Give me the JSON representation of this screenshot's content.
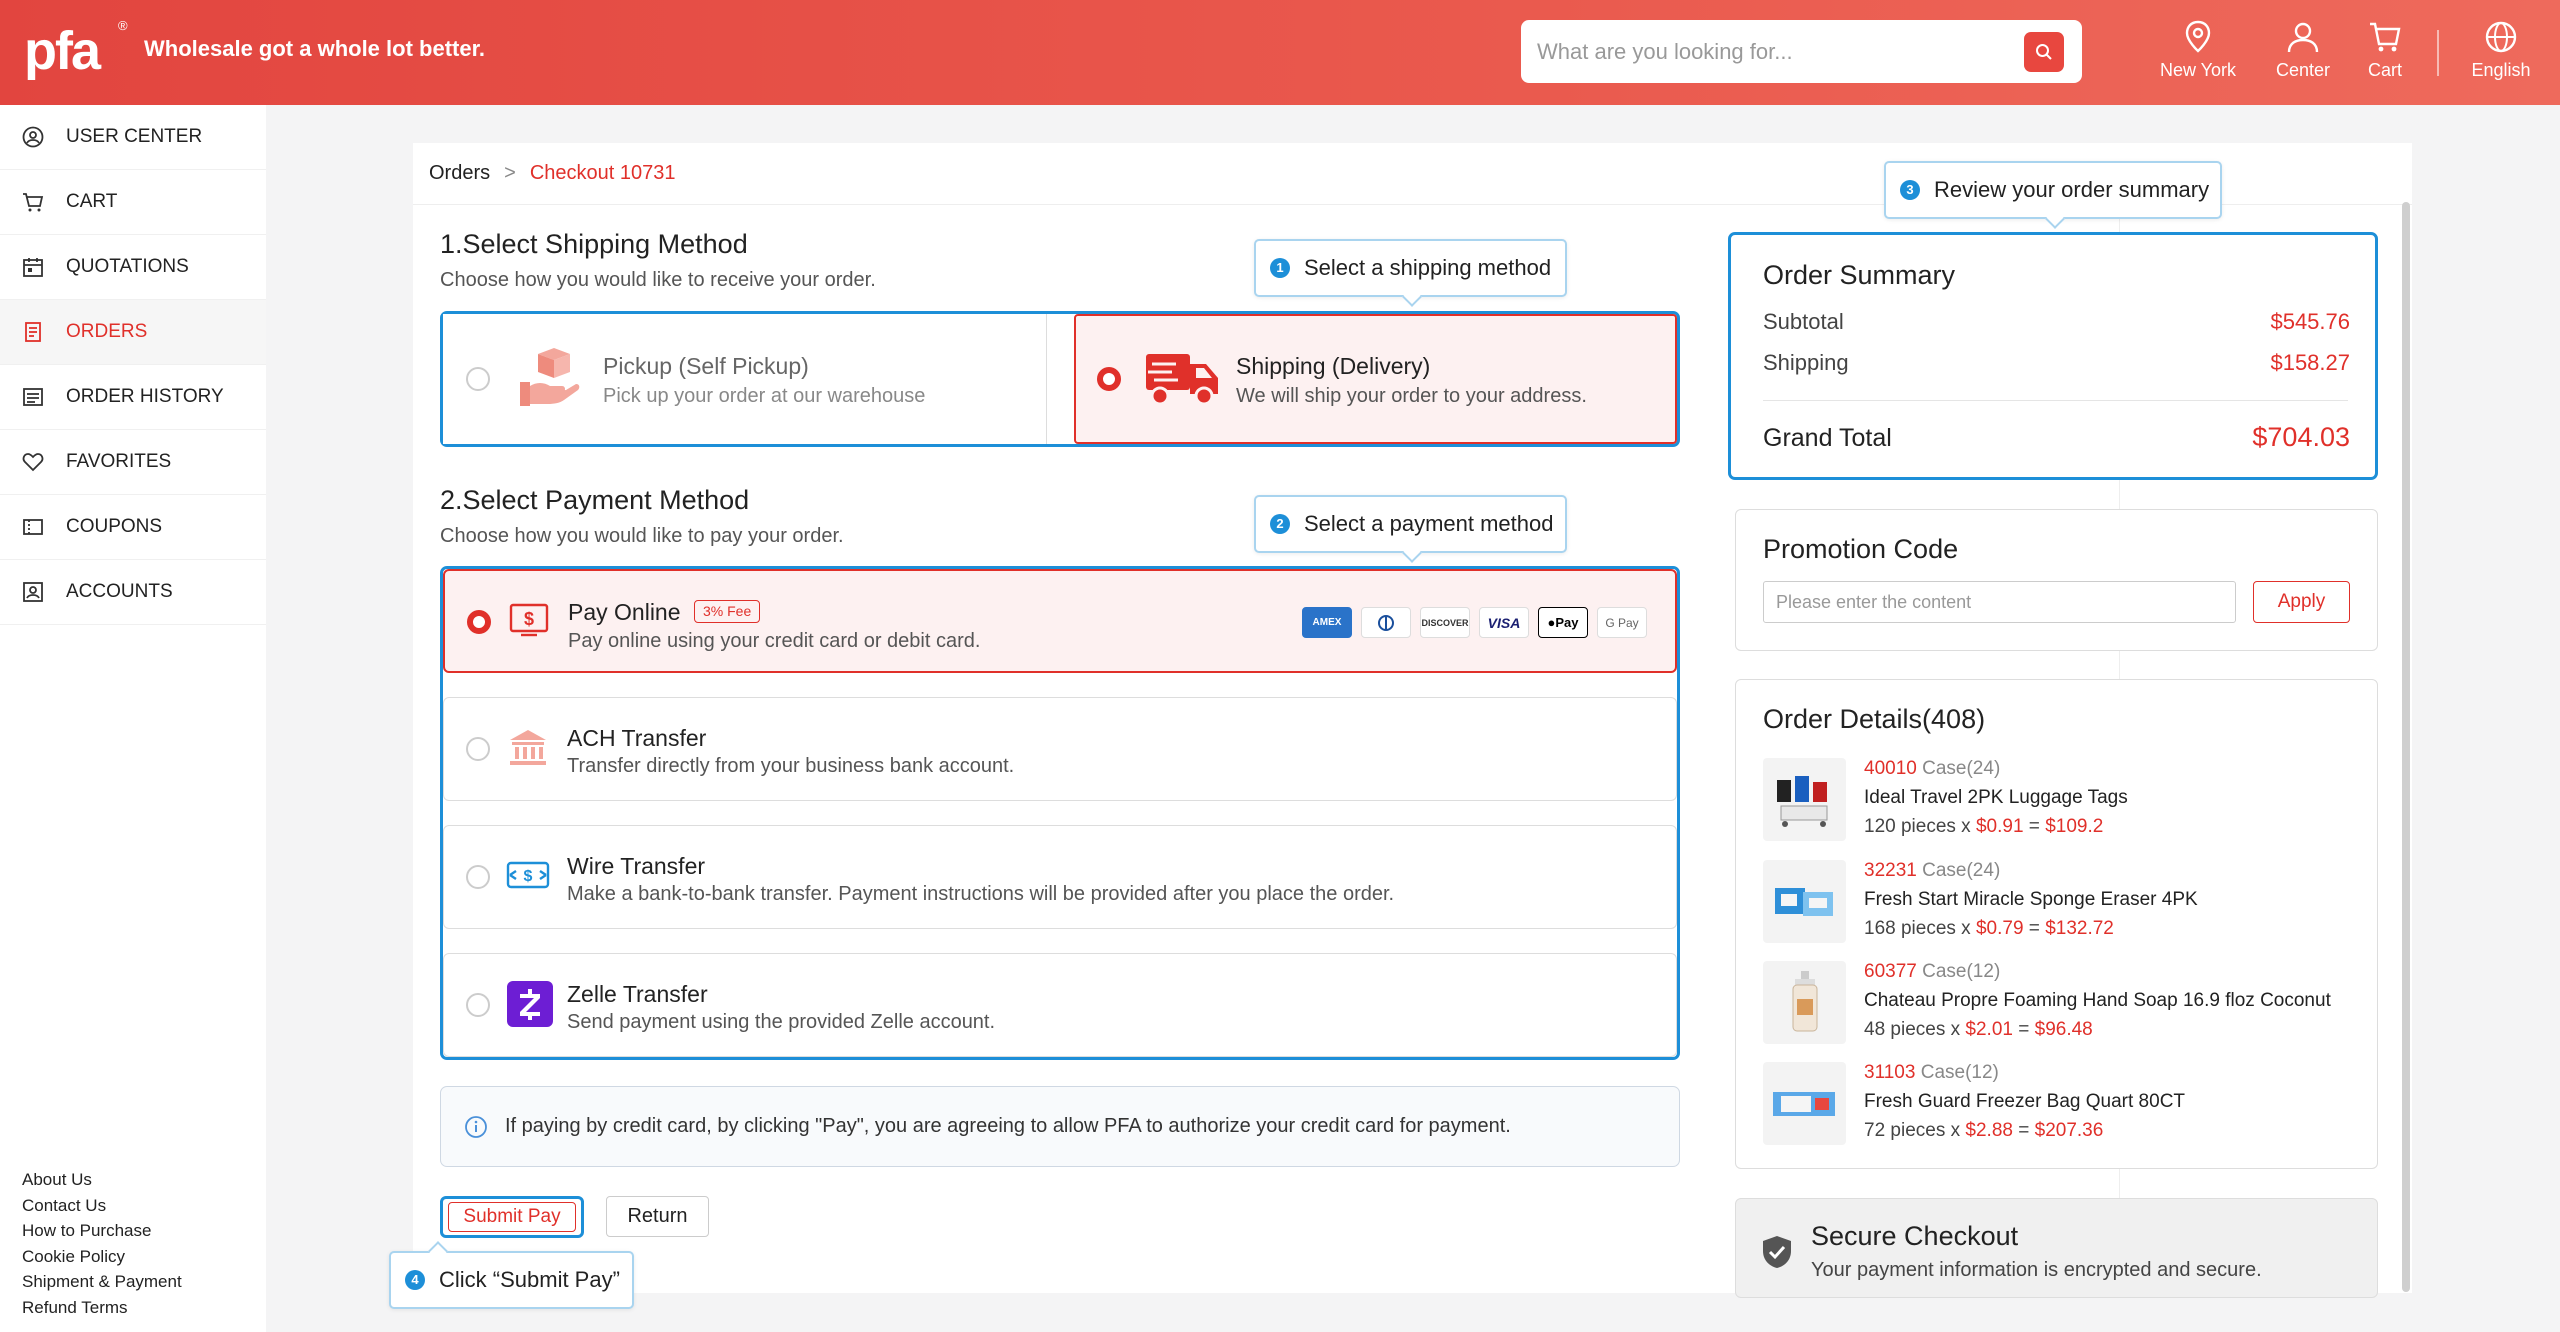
{
  "header": {
    "logo_text": "pfa",
    "logo_mark": "®",
    "tagline": "Wholesale got a whole lot better.",
    "search_placeholder": "What are you looking for...",
    "nav": [
      {
        "label": "New York",
        "icon": "location-pin-icon"
      },
      {
        "label": "Center",
        "icon": "user-icon"
      },
      {
        "label": "Cart",
        "icon": "cart-icon"
      },
      {
        "label": "English",
        "icon": "globe-icon"
      }
    ]
  },
  "sidebar": {
    "items": [
      {
        "label": "USER CENTER",
        "icon": "user-circle-icon"
      },
      {
        "label": "CART",
        "icon": "cart-icon"
      },
      {
        "label": "QUOTATIONS",
        "icon": "calendar-icon"
      },
      {
        "label": "ORDERS",
        "icon": "document-icon",
        "active": true
      },
      {
        "label": "ORDER HISTORY",
        "icon": "list-icon"
      },
      {
        "label": "FAVORITES",
        "icon": "heart-icon"
      },
      {
        "label": "COUPONS",
        "icon": "coupon-icon"
      },
      {
        "label": "ACCOUNTS",
        "icon": "id-card-icon"
      }
    ],
    "footer_links": [
      "About Us",
      "Contact Us",
      "How to Purchase",
      "Cookie Policy",
      "Shipment & Payment",
      "Refund Terms"
    ]
  },
  "breadcrumb": {
    "parent": "Orders",
    "separator": ">",
    "current": "Checkout 10731"
  },
  "shipping": {
    "title": "1.Select Shipping Method",
    "subtitle": "Choose how you would like to receive your order.",
    "options": [
      {
        "title": "Pickup (Self Pickup)",
        "desc": "Pick up your order at our warehouse",
        "selected": false
      },
      {
        "title": "Shipping (Delivery)",
        "desc": "We will ship your order to your address.",
        "selected": true
      }
    ]
  },
  "payment": {
    "title": "2.Select Payment Method",
    "subtitle": "Choose how you would like to pay your order.",
    "options": [
      {
        "title": "Pay Online",
        "fee": "3% Fee",
        "desc": "Pay online using your credit card or debit card.",
        "selected": true
      },
      {
        "title": "ACH Transfer",
        "desc": "Transfer directly from your business bank account.",
        "selected": false
      },
      {
        "title": "Wire Transfer",
        "desc": "Make a bank-to-bank transfer. Payment instructions will be provided after you place the order.",
        "selected": false
      },
      {
        "title": "Zelle Transfer",
        "desc": "Send payment using the provided Zelle account.",
        "selected": false
      }
    ],
    "cards": [
      "AMEX",
      "Diners",
      "DISCOVER",
      "VISA",
      "Pay",
      "G Pay"
    ]
  },
  "notice": "If paying by credit card, by clicking \"Pay\", you are agreeing to allow PFA to authorize your credit card for payment.",
  "buttons": {
    "submit": "Submit Pay",
    "return": "Return"
  },
  "tooltips": [
    {
      "num": "1",
      "text": "Select a shipping method"
    },
    {
      "num": "2",
      "text": "Select a payment method"
    },
    {
      "num": "3",
      "text": "Review your order summary"
    },
    {
      "num": "4",
      "text": "Click “Submit Pay”"
    }
  ],
  "summary": {
    "title": "Order Summary",
    "subtotal_label": "Subtotal",
    "subtotal": "$545.76",
    "shipping_label": "Shipping",
    "shipping": "$158.27",
    "total_label": "Grand Total",
    "total": "$704.03"
  },
  "promo": {
    "title": "Promotion Code",
    "placeholder": "Please enter the content",
    "apply": "Apply"
  },
  "details": {
    "title": "Order Details(408)",
    "items": [
      {
        "code": "40010",
        "pack": "Case(24)",
        "name": "Ideal Travel 2PK Luggage Tags",
        "qty": "120 pieces x",
        "price": "$0.91",
        "eq": "=",
        "total": "$109.2"
      },
      {
        "code": "32231",
        "pack": "Case(24)",
        "name": "Fresh Start Miracle Sponge Eraser 4PK",
        "qty": "168 pieces x",
        "price": "$0.79",
        "eq": "=",
        "total": "$132.72"
      },
      {
        "code": "60377",
        "pack": "Case(12)",
        "name": "Chateau Propre Foaming Hand Soap 16.9 floz Coconut",
        "qty": "48 pieces x",
        "price": "$2.01",
        "eq": "=",
        "total": "$96.48"
      },
      {
        "code": "31103",
        "pack": "Case(12)",
        "name": "Fresh Guard Freezer Bag Quart 80CT",
        "qty": "72 pieces x",
        "price": "$2.88",
        "eq": "=",
        "total": "$207.36"
      }
    ]
  },
  "secure": {
    "title": "Secure Checkout",
    "desc": "Your payment information is encrypted and secure."
  },
  "colors": {
    "brand": "#e2453f",
    "accent_red": "#e0302a",
    "highlight_blue": "#1d8fd8"
  }
}
